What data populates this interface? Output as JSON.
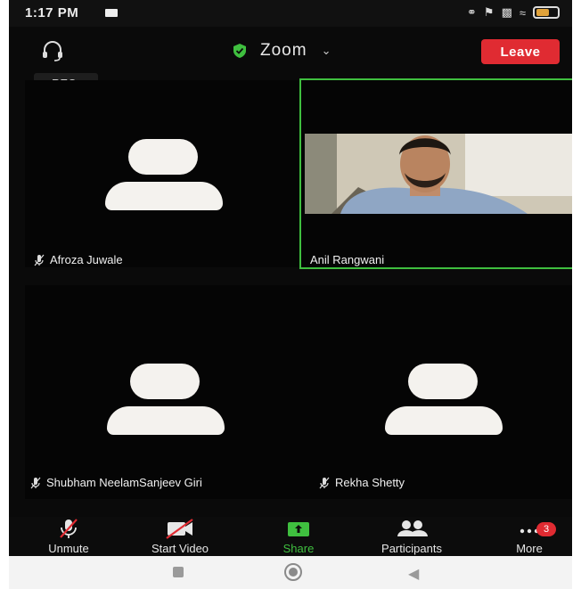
{
  "status_bar": {
    "time": "1:17 PM"
  },
  "header": {
    "title": "Zoom",
    "leave_label": "Leave"
  },
  "recording": {
    "label": "REC"
  },
  "participants": [
    {
      "name": "Afroza Juwale"
    },
    {
      "name": "Anil Rangwani"
    },
    {
      "name": "Shubham NeelamSanjeev Giri"
    },
    {
      "name": "Rekha Shetty"
    }
  ],
  "toolbar": {
    "unmute": "Unmute",
    "start_video": "Start Video",
    "share": "Share",
    "participants": "Participants",
    "more": "More",
    "more_badge": "3"
  },
  "colors": {
    "leave": "#e02b32",
    "active_speaker": "#3fbf3f",
    "share": "#3fbf3f"
  }
}
